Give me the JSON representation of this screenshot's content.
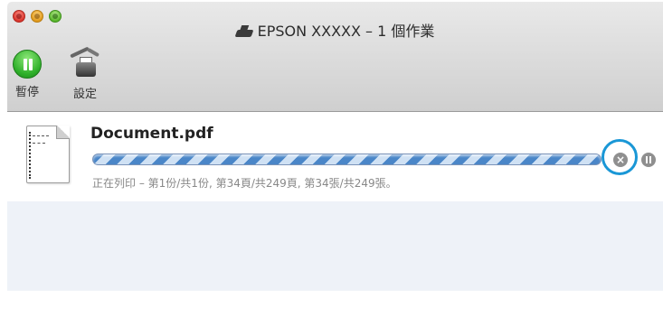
{
  "window": {
    "title": "EPSON XXXXX – 1 個作業",
    "printer_icon": "printer-icon",
    "traffic_lights": [
      "close",
      "minimize",
      "zoom"
    ]
  },
  "toolbar": {
    "pause_label": "暫停",
    "pause_icon": "pause-icon",
    "settings_label": "設定",
    "settings_icon": "printer-settings-icon"
  },
  "job": {
    "document_name": "Document.pdf",
    "document_icon": "document-icon",
    "status_text": "正在列印 – 第1份/共1份, 第34頁/共249頁, 第34張/共249張。",
    "progress_state": "indeterminate",
    "cancel_icon": "cancel-icon",
    "hold_icon": "hold-icon",
    "highlight_color": "#1a97d6",
    "progress_color": "#4a86c8"
  }
}
